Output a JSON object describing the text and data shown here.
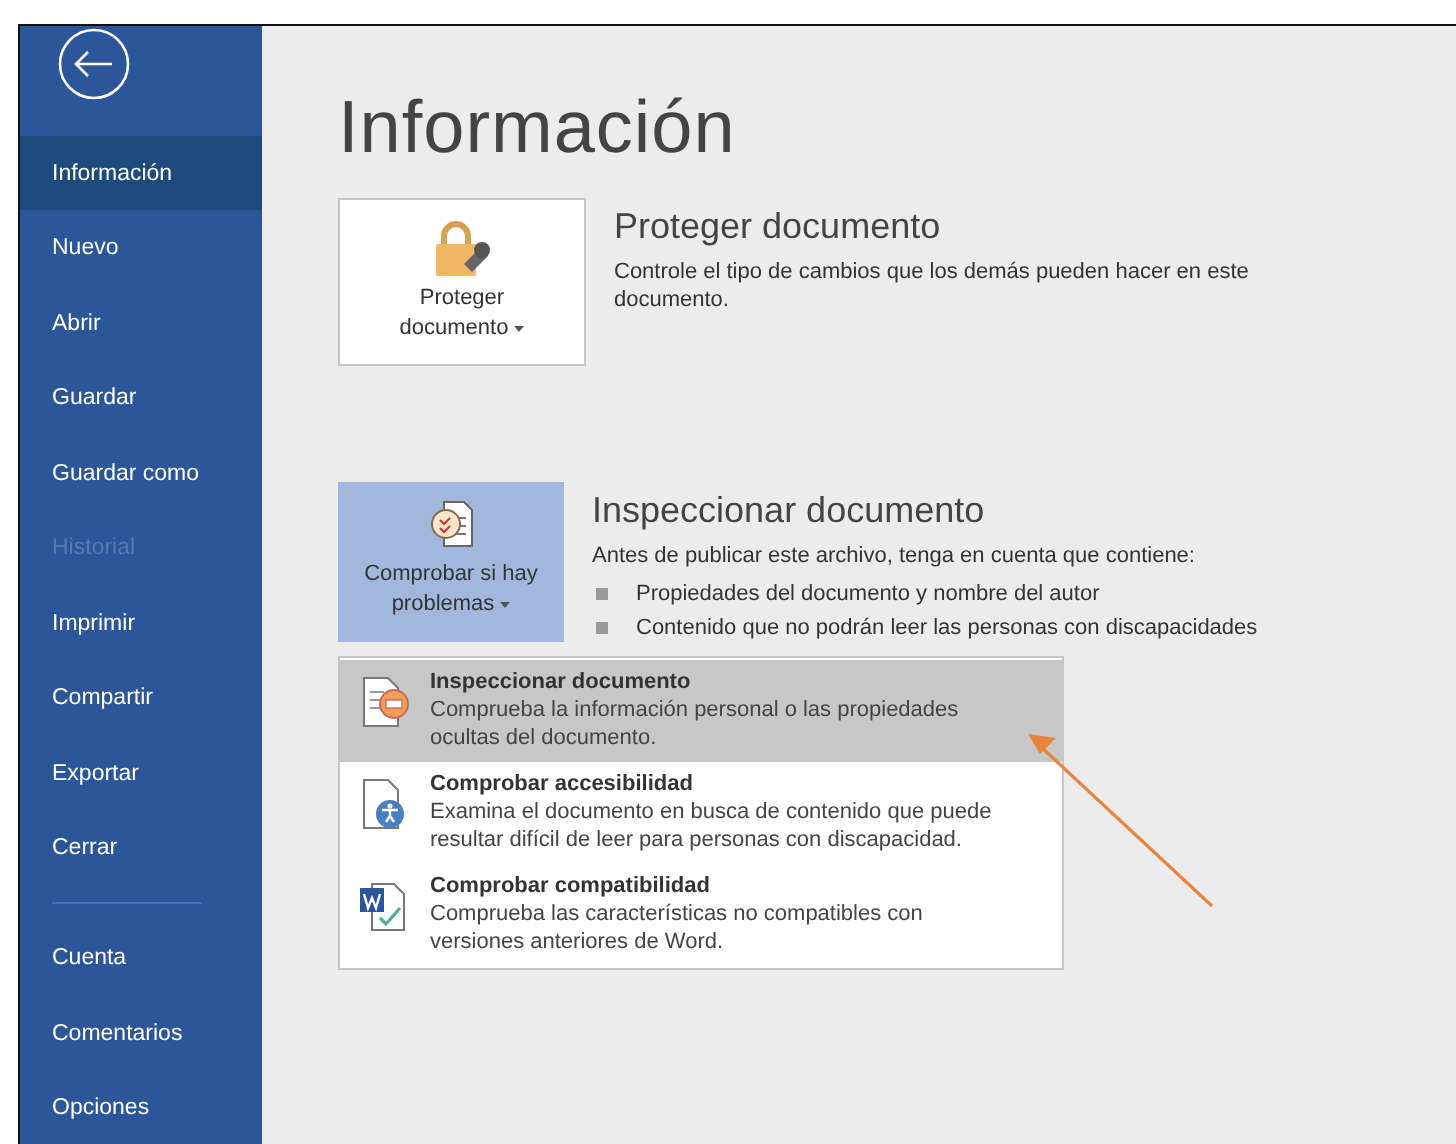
{
  "sidebar": {
    "items": [
      {
        "label": "Información",
        "selected": true,
        "disabled": false
      },
      {
        "label": "Nuevo",
        "selected": false,
        "disabled": false
      },
      {
        "label": "Abrir",
        "selected": false,
        "disabled": false
      },
      {
        "label": "Guardar",
        "selected": false,
        "disabled": false
      },
      {
        "label": "Guardar como",
        "selected": false,
        "disabled": false
      },
      {
        "label": "Historial",
        "selected": false,
        "disabled": true
      },
      {
        "label": "Imprimir",
        "selected": false,
        "disabled": false
      },
      {
        "label": "Compartir",
        "selected": false,
        "disabled": false
      },
      {
        "label": "Exportar",
        "selected": false,
        "disabled": false
      },
      {
        "label": "Cerrar",
        "selected": false,
        "disabled": false
      }
    ],
    "footer_items": [
      {
        "label": "Cuenta",
        "selected": false,
        "disabled": false
      },
      {
        "label": "Comentarios",
        "selected": false,
        "disabled": false
      },
      {
        "label": "Opciones",
        "selected": false,
        "disabled": false
      }
    ]
  },
  "main": {
    "title": "Información",
    "sections": [
      {
        "kind": "protect",
        "button": {
          "label": "Proteger documento",
          "expanded": false
        },
        "title": "Proteger documento",
        "description": "Controle el tipo de cambios que los demás pueden hacer en este documento."
      },
      {
        "kind": "inspect",
        "button": {
          "label": "Comprobar si hay problemas",
          "expanded": true
        },
        "title": "Inspeccionar documento",
        "description": "Antes de publicar este archivo, tenga en cuenta que contiene:",
        "bullets": [
          "Propiedades del documento y nombre del autor",
          "Contenido que no podrán leer las personas con discapacidades"
        ]
      }
    ]
  },
  "menu": {
    "items": [
      {
        "kind": "inspect",
        "title": "Inspeccionar documento",
        "description": "Comprueba la información personal o las propiedades ocultas del documento.",
        "selected": true
      },
      {
        "kind": "accessibility",
        "title": "Comprobar accesibilidad",
        "description": "Examina el documento en busca de contenido que puede resultar difícil de leer para personas con discapacidad.",
        "selected": false
      },
      {
        "kind": "compatibility",
        "title": "Comprobar compatibilidad",
        "description": "Comprueba las características no compatibles con versiones anteriores de Word.",
        "selected": false
      }
    ]
  }
}
